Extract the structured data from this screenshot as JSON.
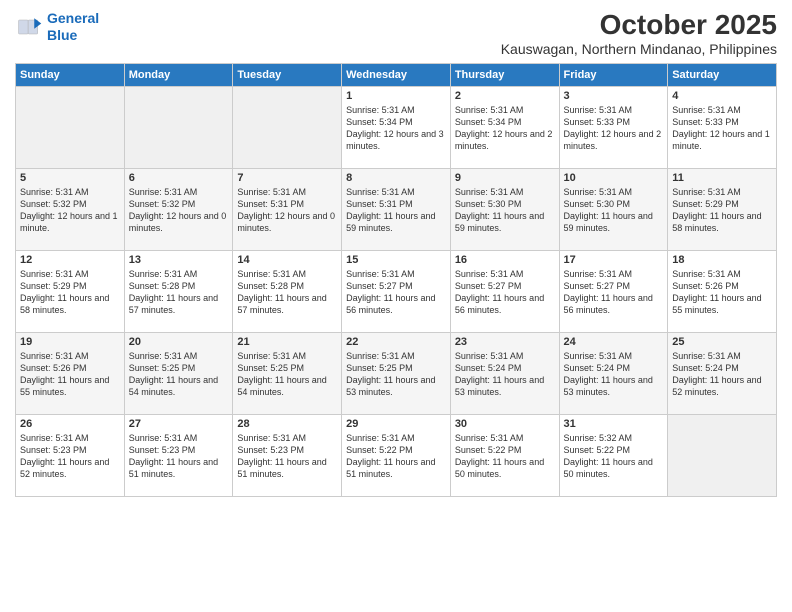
{
  "logo": {
    "line1": "General",
    "line2": "Blue"
  },
  "title": "October 2025",
  "location": "Kauswagan, Northern Mindanao, Philippines",
  "days_of_week": [
    "Sunday",
    "Monday",
    "Tuesday",
    "Wednesday",
    "Thursday",
    "Friday",
    "Saturday"
  ],
  "weeks": [
    [
      {
        "day": "",
        "info": ""
      },
      {
        "day": "",
        "info": ""
      },
      {
        "day": "",
        "info": ""
      },
      {
        "day": "1",
        "info": "Sunrise: 5:31 AM\nSunset: 5:34 PM\nDaylight: 12 hours and 3 minutes."
      },
      {
        "day": "2",
        "info": "Sunrise: 5:31 AM\nSunset: 5:34 PM\nDaylight: 12 hours and 2 minutes."
      },
      {
        "day": "3",
        "info": "Sunrise: 5:31 AM\nSunset: 5:33 PM\nDaylight: 12 hours and 2 minutes."
      },
      {
        "day": "4",
        "info": "Sunrise: 5:31 AM\nSunset: 5:33 PM\nDaylight: 12 hours and 1 minute."
      }
    ],
    [
      {
        "day": "5",
        "info": "Sunrise: 5:31 AM\nSunset: 5:32 PM\nDaylight: 12 hours and 1 minute."
      },
      {
        "day": "6",
        "info": "Sunrise: 5:31 AM\nSunset: 5:32 PM\nDaylight: 12 hours and 0 minutes."
      },
      {
        "day": "7",
        "info": "Sunrise: 5:31 AM\nSunset: 5:31 PM\nDaylight: 12 hours and 0 minutes."
      },
      {
        "day": "8",
        "info": "Sunrise: 5:31 AM\nSunset: 5:31 PM\nDaylight: 11 hours and 59 minutes."
      },
      {
        "day": "9",
        "info": "Sunrise: 5:31 AM\nSunset: 5:30 PM\nDaylight: 11 hours and 59 minutes."
      },
      {
        "day": "10",
        "info": "Sunrise: 5:31 AM\nSunset: 5:30 PM\nDaylight: 11 hours and 59 minutes."
      },
      {
        "day": "11",
        "info": "Sunrise: 5:31 AM\nSunset: 5:29 PM\nDaylight: 11 hours and 58 minutes."
      }
    ],
    [
      {
        "day": "12",
        "info": "Sunrise: 5:31 AM\nSunset: 5:29 PM\nDaylight: 11 hours and 58 minutes."
      },
      {
        "day": "13",
        "info": "Sunrise: 5:31 AM\nSunset: 5:28 PM\nDaylight: 11 hours and 57 minutes."
      },
      {
        "day": "14",
        "info": "Sunrise: 5:31 AM\nSunset: 5:28 PM\nDaylight: 11 hours and 57 minutes."
      },
      {
        "day": "15",
        "info": "Sunrise: 5:31 AM\nSunset: 5:27 PM\nDaylight: 11 hours and 56 minutes."
      },
      {
        "day": "16",
        "info": "Sunrise: 5:31 AM\nSunset: 5:27 PM\nDaylight: 11 hours and 56 minutes."
      },
      {
        "day": "17",
        "info": "Sunrise: 5:31 AM\nSunset: 5:27 PM\nDaylight: 11 hours and 56 minutes."
      },
      {
        "day": "18",
        "info": "Sunrise: 5:31 AM\nSunset: 5:26 PM\nDaylight: 11 hours and 55 minutes."
      }
    ],
    [
      {
        "day": "19",
        "info": "Sunrise: 5:31 AM\nSunset: 5:26 PM\nDaylight: 11 hours and 55 minutes."
      },
      {
        "day": "20",
        "info": "Sunrise: 5:31 AM\nSunset: 5:25 PM\nDaylight: 11 hours and 54 minutes."
      },
      {
        "day": "21",
        "info": "Sunrise: 5:31 AM\nSunset: 5:25 PM\nDaylight: 11 hours and 54 minutes."
      },
      {
        "day": "22",
        "info": "Sunrise: 5:31 AM\nSunset: 5:25 PM\nDaylight: 11 hours and 53 minutes."
      },
      {
        "day": "23",
        "info": "Sunrise: 5:31 AM\nSunset: 5:24 PM\nDaylight: 11 hours and 53 minutes."
      },
      {
        "day": "24",
        "info": "Sunrise: 5:31 AM\nSunset: 5:24 PM\nDaylight: 11 hours and 53 minutes."
      },
      {
        "day": "25",
        "info": "Sunrise: 5:31 AM\nSunset: 5:24 PM\nDaylight: 11 hours and 52 minutes."
      }
    ],
    [
      {
        "day": "26",
        "info": "Sunrise: 5:31 AM\nSunset: 5:23 PM\nDaylight: 11 hours and 52 minutes."
      },
      {
        "day": "27",
        "info": "Sunrise: 5:31 AM\nSunset: 5:23 PM\nDaylight: 11 hours and 51 minutes."
      },
      {
        "day": "28",
        "info": "Sunrise: 5:31 AM\nSunset: 5:23 PM\nDaylight: 11 hours and 51 minutes."
      },
      {
        "day": "29",
        "info": "Sunrise: 5:31 AM\nSunset: 5:22 PM\nDaylight: 11 hours and 51 minutes."
      },
      {
        "day": "30",
        "info": "Sunrise: 5:31 AM\nSunset: 5:22 PM\nDaylight: 11 hours and 50 minutes."
      },
      {
        "day": "31",
        "info": "Sunrise: 5:32 AM\nSunset: 5:22 PM\nDaylight: 11 hours and 50 minutes."
      },
      {
        "day": "",
        "info": ""
      }
    ]
  ]
}
